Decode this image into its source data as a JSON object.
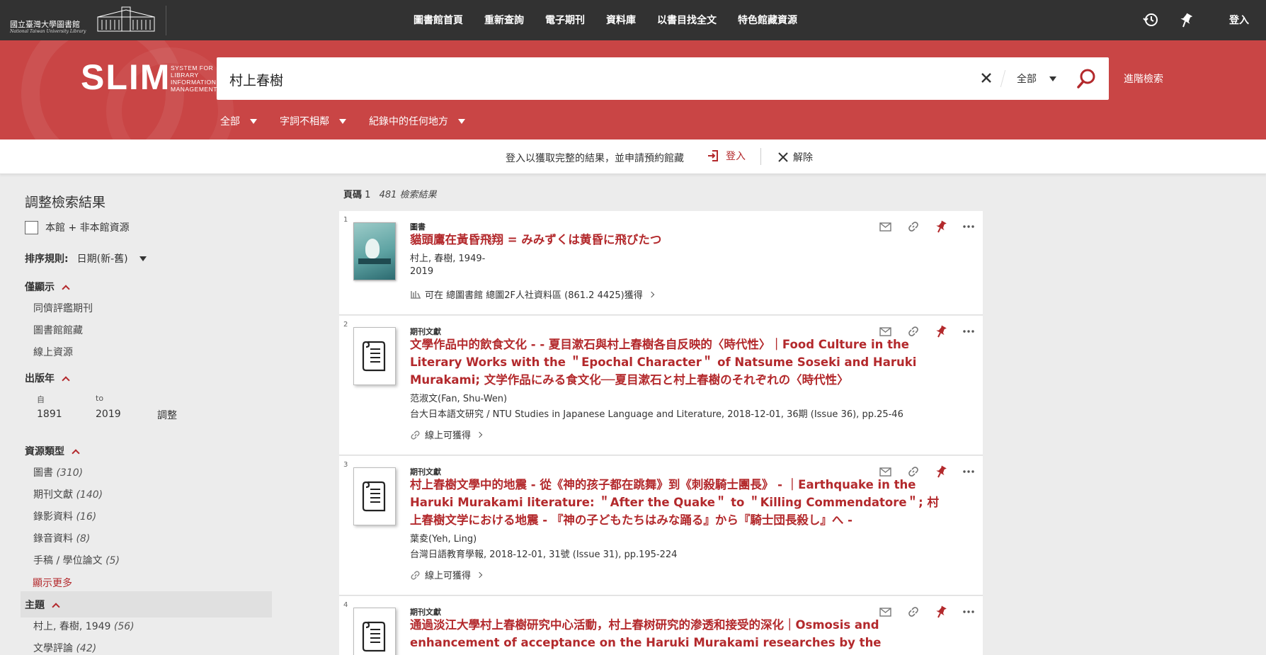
{
  "header": {
    "library_logo_text": "國立臺灣大學圖書館",
    "library_logo_subtext": "National Taiwan University Library",
    "nav": [
      "圖書館首頁",
      "重新查詢",
      "電子期刊",
      "資料庫",
      "以書目找全文",
      "特色館藏資源"
    ],
    "login_label": "登入"
  },
  "search": {
    "logo_text": "SLIM",
    "logo_subtitle": [
      "SYSTEM FOR",
      "LIBRARY",
      "INFORMATION",
      "MANAGEMENT"
    ],
    "query": "村上春樹",
    "scope": "全部",
    "advanced_label": "進階檢索",
    "filters": [
      "全部",
      "字詞不相鄰",
      "紀錄中的任何地方"
    ]
  },
  "notice": {
    "message": "登入以獲取完整的結果，並申請預約館藏",
    "login_label": "登入",
    "dismiss_label": "解除"
  },
  "sidebar": {
    "title": "調整檢索結果",
    "checkbox_label": "本館 + 非本館資源",
    "sort_label": "排序規則:",
    "sort_value": "日期(新-舊)",
    "show_only": {
      "heading": "僅顯示",
      "items": [
        "同儕評鑑期刊",
        "圖書館館藏",
        "線上資源"
      ]
    },
    "pub_year": {
      "heading": "出版年",
      "from_label": "自",
      "to_label": "to",
      "from_value": "1891",
      "to_value": "2019",
      "apply_label": "調整"
    },
    "resource_type": {
      "heading": "資源類型",
      "items": [
        {
          "label": "圖書",
          "count": "(310)"
        },
        {
          "label": "期刊文獻",
          "count": "(140)"
        },
        {
          "label": "錄影資料",
          "count": "(16)"
        },
        {
          "label": "錄音資料",
          "count": "(8)"
        },
        {
          "label": "手稿 / 學位論文",
          "count": "(5)"
        }
      ],
      "more_label": "顯示更多"
    },
    "subject": {
      "heading": "主題",
      "items": [
        {
          "label": "村上, 春樹, 1949",
          "count": "(56)"
        },
        {
          "label": "文學評論",
          "count": "(42)"
        }
      ]
    }
  },
  "results": {
    "page_label": "頁碼",
    "page_number": "1",
    "count_text": "481 檢索結果",
    "items": [
      {
        "num": "1",
        "type": "圖書",
        "title": "貓頭鷹在黃昏飛翔 = みみずくは黄昏に飛びたつ",
        "author": "村上, 春樹, 1949-",
        "detail": "2019",
        "availability": "可在 總圖書館  總圖2F人社資料區 (861.2 4425)獲得"
      },
      {
        "num": "2",
        "type": "期刊文獻",
        "title": "文學作品中的飲食文化 - - 夏目漱石與村上春樹各自反映的〈時代性〉｜Food Culture in the Literary Works with the ＂Epochal Character＂ of Natsume Soseki and Haruki Murakami; 文学作品にみる食文化──夏目漱石と村上春樹のそれぞれの〈時代性〉",
        "author": "范淑文(Fan, Shu-Wen)",
        "detail": "台大日本語文研究 / NTU Studies in Japanese Language and Literature, 2018-12-01, 36期 (Issue 36), pp.25-46",
        "availability": "線上可獲得"
      },
      {
        "num": "3",
        "type": "期刊文獻",
        "title": "村上春樹文學中的地震 - 從《神的孩子都在跳舞》到《刺殺騎士團長》 - ｜Earthquake in the Haruki Murakami literature: ＂After the Quake＂ to ＂Killing Commendatore＂; 村上春樹文学における地震 - 『神の子どもたちはみな踊る』から『騎士団長殺し』へ -",
        "author": "葉夌(Yeh, Ling)",
        "detail": "台灣日語教育學報, 2018-12-01, 31號 (Issue 31), pp.195-224",
        "availability": "線上可獲得"
      },
      {
        "num": "4",
        "type": "期刊文獻",
        "title": "通過淡江大學村上春樹研究中心活動，村上春树研究的渗透和接受的深化｜Osmosis and enhancement of acceptance on the Haruki Murakami researches by the activities of CMSTKU; the",
        "author": "",
        "detail": "",
        "availability": ""
      }
    ]
  },
  "colors": {
    "topbar": "#323232",
    "band": "#c94545",
    "accent": "#b3292c"
  },
  "icons": [
    "history-icon",
    "pin-icon",
    "clear-icon",
    "search-icon",
    "login-icon",
    "close-icon",
    "email-icon",
    "link-icon",
    "pin-icon",
    "more-icon",
    "shelf-icon",
    "chain-icon",
    "document-icon"
  ]
}
